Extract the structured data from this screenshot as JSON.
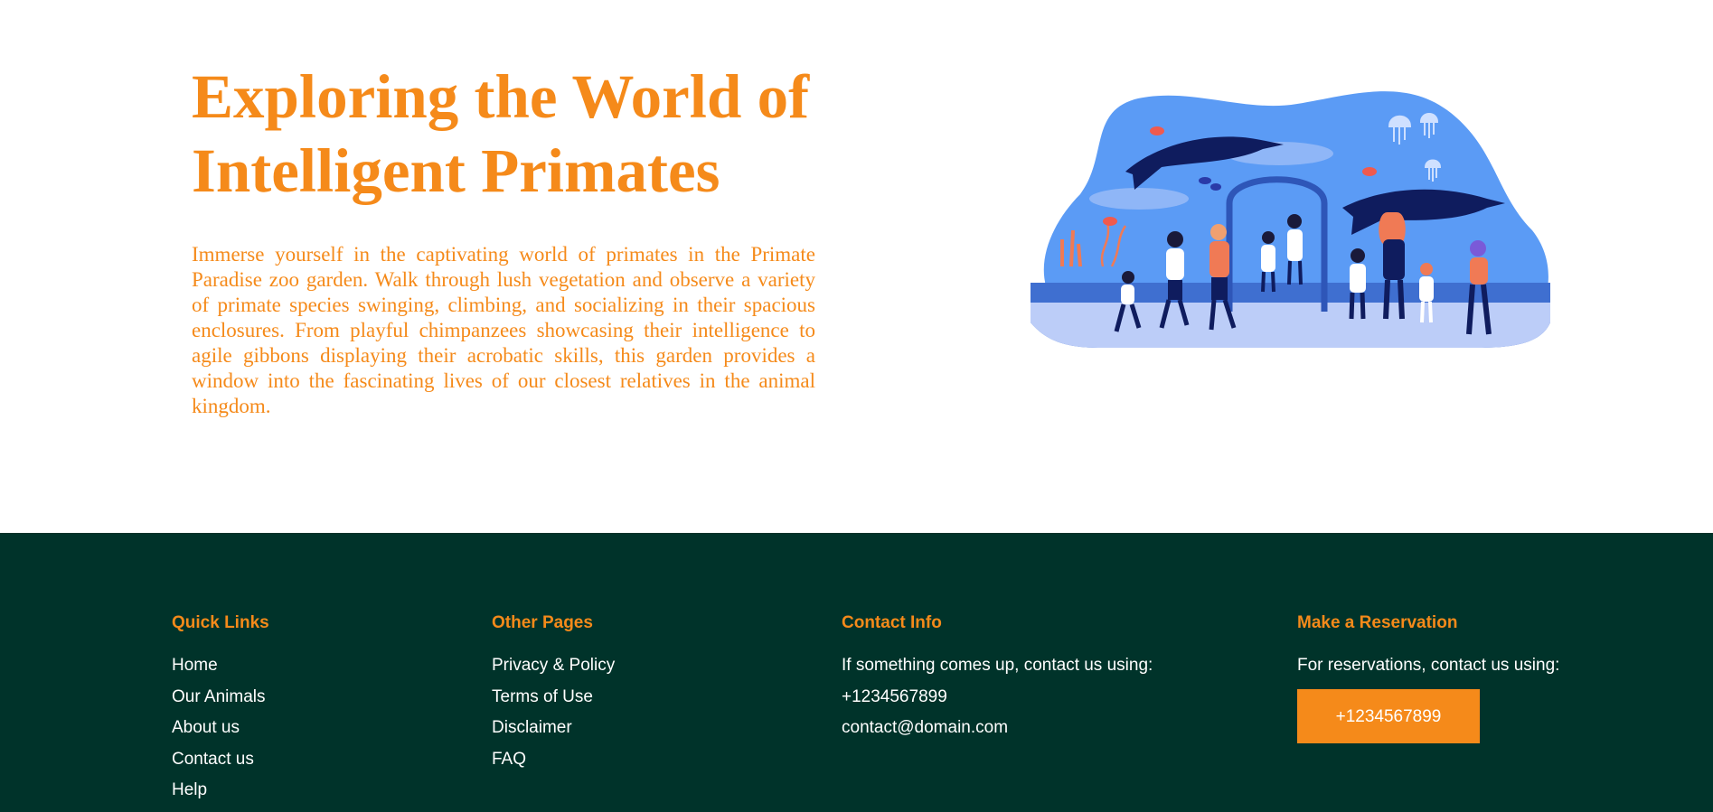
{
  "hero": {
    "title": "Exploring the World of Intelligent Primates",
    "description": "Immerse yourself in the captivating world of primates in the Primate Paradise zoo garden. Walk through lush vegetation and observe a variety of primate species swinging, climbing, and socializing in their spacious enclosures. From playful chimpanzees showcasing their intelligence to agile gibbons displaying their acrobatic skills, this garden provides a window into the fascinating lives of our closest relatives in the animal kingdom."
  },
  "footer": {
    "quick_links": {
      "heading": "Quick Links",
      "items": [
        "Home",
        "Our Animals",
        "About us",
        "Contact us",
        "Help"
      ]
    },
    "other_pages": {
      "heading": "Other Pages",
      "items": [
        "Privacy & Policy",
        "Terms of Use",
        "Disclaimer",
        "FAQ"
      ]
    },
    "contact_info": {
      "heading": "Contact Info",
      "lines": [
        "If something comes up, contact us using:",
        "+1234567899",
        "contact@domain.com"
      ]
    },
    "reservation": {
      "heading": "Make a Reservation",
      "text": "For reservations, contact us using:",
      "button_label": "+1234567899"
    }
  },
  "colors": {
    "accent": "#f58a1a",
    "footer_bg": "#00332a",
    "aquarium_blue": "#5b9bf5",
    "dolphin_navy": "#0f1c5e"
  }
}
